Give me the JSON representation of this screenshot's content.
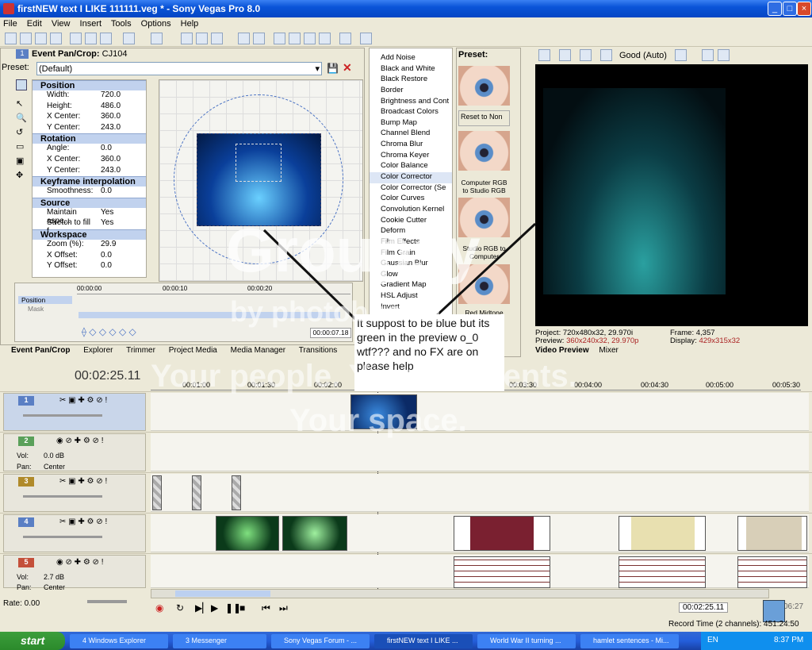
{
  "window": {
    "title": "firstNEW text I LIKE 111111.veg * - Sony Vegas Pro 8.0"
  },
  "menu": [
    "File",
    "Edit",
    "View",
    "Insert",
    "Tools",
    "Options",
    "Help"
  ],
  "panzoom": {
    "header": "Event Pan/Crop:",
    "clip": "CJ104",
    "preset_label": "Preset:",
    "preset_value": "(Default)",
    "sections": [
      {
        "title": "Position",
        "rows": [
          [
            "Width:",
            "720.0"
          ],
          [
            "Height:",
            "486.0"
          ],
          [
            "X Center:",
            "360.0"
          ],
          [
            "Y Center:",
            "243.0"
          ]
        ]
      },
      {
        "title": "Rotation",
        "rows": [
          [
            "Angle:",
            "0.0"
          ],
          [
            "X Center:",
            "360.0"
          ],
          [
            "Y Center:",
            "243.0"
          ]
        ]
      },
      {
        "title": "Keyframe interpolation",
        "rows": [
          [
            "Smoothness:",
            "0.0"
          ]
        ]
      },
      {
        "title": "Source",
        "rows": [
          [
            "Maintain aspe...",
            "Yes"
          ],
          [
            "Stretch to fill f...",
            "Yes"
          ]
        ]
      },
      {
        "title": "Workspace",
        "rows": [
          [
            "Zoom (%):",
            "29.9"
          ],
          [
            "X Offset:",
            "0.0"
          ],
          [
            "Y Offset:",
            "0.0"
          ]
        ]
      }
    ],
    "kf_ruler": [
      "00:00:00",
      "00:00:10",
      "00:00:20"
    ],
    "kf_tracks": [
      "Position",
      "Mask"
    ],
    "kf_time": "00:00:07.18"
  },
  "tabs_left": [
    "Event Pan/Crop",
    "Explorer",
    "Trimmer",
    "Project Media",
    "Media Manager",
    "Transitions"
  ],
  "fx": [
    "Add Noise",
    "Black and White",
    "Black Restore",
    "Border",
    "Brightness and Cont",
    "Broadcast Colors",
    "Bump Map",
    "Channel Blend",
    "Chroma Blur",
    "Chroma Keyer",
    "Color Balance",
    "Color Corrector",
    "Color Corrector (Se",
    "Color Curves",
    "Convolution Kernel",
    "Cookie Cutter",
    "Deform",
    "Film Effects",
    "Film Grain",
    "Gaussian Blur",
    "Glow",
    "Gradient Map",
    "HSL Adjust",
    "Invert"
  ],
  "fx_preset": {
    "label": "Preset:",
    "items": [
      "Reset to Non",
      "Computer RGB to Studio RGB",
      "Studio RGB to Computer",
      "Red Midtone"
    ]
  },
  "preview": {
    "quality": "Good (Auto)",
    "project_label": "Project:",
    "project": "720x480x32, 29.970i",
    "preview_label": "Preview:",
    "preview_value": "360x240x32, 29.970p",
    "frame_label": "Frame:",
    "frame": "4,357",
    "display_label": "Display:",
    "display": "429x315x32",
    "tabs": [
      "Video Preview",
      "Mixer"
    ]
  },
  "timeline": {
    "timecode": "00:02:25.11",
    "ruler": [
      "00:01:00",
      "00:01:30",
      "00:02:00",
      "00:03:30",
      "00:04:00",
      "00:04:30",
      "00:05:00",
      "00:05:30"
    ],
    "tracks": [
      {
        "num": "1",
        "type": "video"
      },
      {
        "num": "2",
        "type": "audio",
        "vol": "0.0 dB",
        "pan": "Center"
      },
      {
        "num": "3",
        "type": "video"
      },
      {
        "num": "4",
        "type": "video"
      },
      {
        "num": "5",
        "type": "audio",
        "vol": "2.7 dB",
        "pan": "Center"
      }
    ],
    "vol_label": "Vol:",
    "pan_label": "Pan:"
  },
  "status": {
    "rate": "Rate: 0.00",
    "time": "00:02:25.11",
    "record": "Record Time (2 channels): 451:24:50",
    "extra": "06:27"
  },
  "taskbar": {
    "start": "start",
    "tasks": [
      "4 Windows Explorer",
      "3 Messenger",
      "Sony Vegas Forum - ...",
      "firstNEW text I LIKE ...",
      "World War II turning ...",
      "hamlet sentences - Mi..."
    ],
    "lang": "EN",
    "clock": "8:37 PM"
  },
  "note": "It suppost to be blue but its green in the preview o_0 wtf??? and no FX are on please help",
  "watermark": {
    "brand": "Groupsy",
    "by": "by photobucket",
    "tag1": "Your people. Your moments.",
    "tag2": "Your space."
  }
}
